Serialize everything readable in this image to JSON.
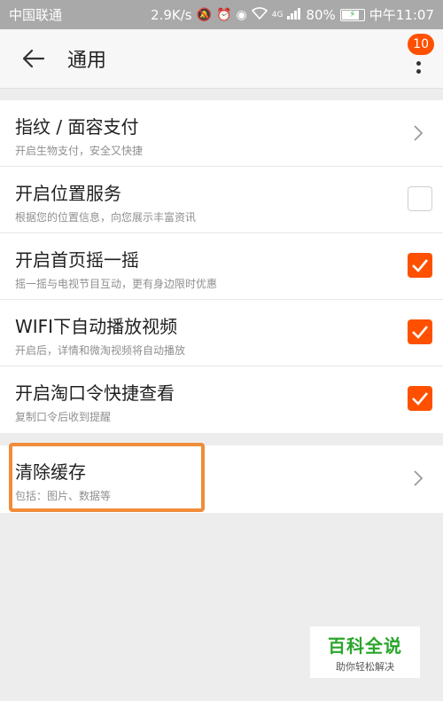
{
  "status_bar": {
    "carrier": "中国联通",
    "speed": "2.9K/s",
    "network": "4G",
    "battery": "80%",
    "time": "中午11:07"
  },
  "app_bar": {
    "title": "通用",
    "badge_count": "10"
  },
  "settings": [
    {
      "title": "指纹 / 面容支付",
      "subtitle": "开启生物支付，安全又快捷",
      "control": "chevron"
    },
    {
      "title": "开启位置服务",
      "subtitle": "根据您的位置信息，向您展示丰富资讯",
      "control": "checkbox",
      "checked": false
    },
    {
      "title": "开启首页摇一摇",
      "subtitle": "摇一摇与电视节目互动，更有身边限时优惠",
      "control": "checkbox",
      "checked": true
    },
    {
      "title": "WIFI下自动播放视频",
      "subtitle": "开启后，详情和微淘视频将自动播放",
      "control": "checkbox",
      "checked": true
    },
    {
      "title": "开启淘口令快捷查看",
      "subtitle": "复制口令后收到提醒",
      "control": "checkbox",
      "checked": true
    }
  ],
  "cache": {
    "title": "清除缓存",
    "subtitle": "包括：图片、数据等"
  },
  "watermark": {
    "main": "百科全说",
    "sub": "助你轻松解决"
  },
  "colors": {
    "accent": "#ff5000",
    "highlight": "#f08c3a",
    "status_bar": "#a9a9a9"
  }
}
